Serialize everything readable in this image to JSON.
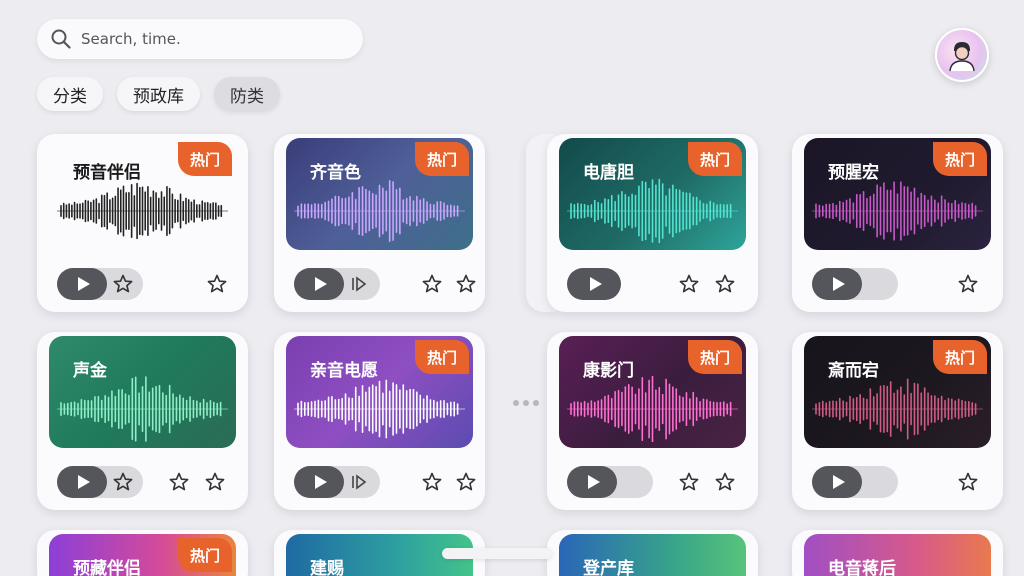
{
  "search": {
    "placeholder": "Search, time.",
    "icon": "search-icon"
  },
  "profile": {
    "icon": "avatar-icon"
  },
  "filters": [
    {
      "label": "分类",
      "active": false
    },
    {
      "label": "预政库",
      "active": false
    },
    {
      "label": "防类",
      "active": true
    }
  ],
  "badge_label": "热门",
  "colors": {
    "hot_badge": "#e8632b",
    "play_button": "#55565c"
  },
  "cards": [
    {
      "title": "预音伴侣",
      "hot": true,
      "style": "plain",
      "wave": "#222222"
    },
    {
      "title": "齐音色",
      "hot": true,
      "style": "indigo",
      "wave": "#c9a6ff"
    },
    {
      "title": "电唐胆",
      "hot": true,
      "style": "teal",
      "wave": "#54e3cf"
    },
    {
      "title": "预腥宏",
      "hot": true,
      "style": "black-purple",
      "wave": "#c958c9"
    },
    {
      "title": "声金",
      "hot": false,
      "style": "green",
      "wave": "#8ff0c8"
    },
    {
      "title": "亲音电愿",
      "hot": true,
      "style": "purple",
      "wave": "#ffffff"
    },
    {
      "title": "康影门",
      "hot": true,
      "style": "magenta",
      "wave": "#ff6fd1"
    },
    {
      "title": "斎而宕",
      "hot": true,
      "style": "black-red",
      "wave": "#d05b85"
    },
    {
      "title": "预藏伴侣",
      "hot": true,
      "style": "pink-blue"
    },
    {
      "title": "建赐",
      "hot": false,
      "style": "teal-blue"
    },
    {
      "title": "登产库",
      "hot": false,
      "style": "blue-green"
    },
    {
      "title": "电音蒋后",
      "hot": false,
      "style": "pink-orange"
    }
  ]
}
